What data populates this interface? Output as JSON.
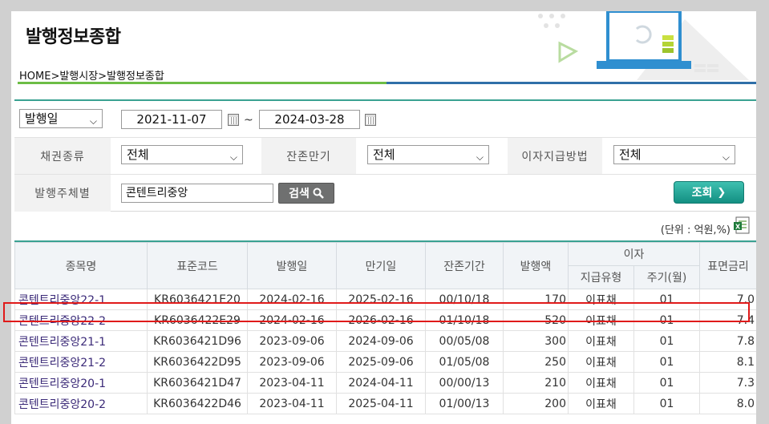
{
  "page": {
    "title": "발행정보종합",
    "breadcrumb": "HOME>발행시장>발행정보종합"
  },
  "search": {
    "date_type": "발행일",
    "date_from": "2021-11-07",
    "date_tilde": "~",
    "date_to": "2024-03-28",
    "bond_type_label": "채권종류",
    "bond_type_value": "전체",
    "remaining_label": "잔존만기",
    "remaining_value": "전체",
    "interest_method_label": "이자지급방법",
    "interest_method_value": "전체",
    "issuer_label": "발행주체별",
    "issuer_value": "콘텐트리중앙",
    "search_button": "검색",
    "query_button": "조회"
  },
  "unit_text": "(단위 : 억원,%)",
  "table": {
    "headers": {
      "name": "종목명",
      "code": "표준코드",
      "issue_date": "발행일",
      "maturity": "만기일",
      "remaining": "잔존기간",
      "amount": "발행액",
      "interest": "이자",
      "pay_type": "지급유형",
      "period": "주기(월)",
      "coupon": "표면금리"
    },
    "rows": [
      {
        "name": "콘텐트리중앙22-1",
        "code": "KR6036421E20",
        "issue": "2024-02-16",
        "maturity": "2025-02-16",
        "remaining": "00/10/18",
        "amount": "170",
        "pay_type": "이표채",
        "period": "01",
        "coupon": "7.0"
      },
      {
        "name": "콘텐트리중앙22-2",
        "code": "KR6036422E29",
        "issue": "2024-02-16",
        "maturity": "2026-02-16",
        "remaining": "01/10/18",
        "amount": "520",
        "pay_type": "이표채",
        "period": "01",
        "coupon": "7.4"
      },
      {
        "name": "콘텐트리중앙21-1",
        "code": "KR6036421D96",
        "issue": "2023-09-06",
        "maturity": "2024-09-06",
        "remaining": "00/05/08",
        "amount": "300",
        "pay_type": "이표채",
        "period": "01",
        "coupon": "7.8"
      },
      {
        "name": "콘텐트리중앙21-2",
        "code": "KR6036422D95",
        "issue": "2023-09-06",
        "maturity": "2025-09-06",
        "remaining": "01/05/08",
        "amount": "250",
        "pay_type": "이표채",
        "period": "01",
        "coupon": "8.1"
      },
      {
        "name": "콘텐트리중앙20-1",
        "code": "KR6036421D47",
        "issue": "2023-04-11",
        "maturity": "2024-04-11",
        "remaining": "00/00/13",
        "amount": "210",
        "pay_type": "이표채",
        "period": "01",
        "coupon": "7.3"
      },
      {
        "name": "콘텐트리중앙20-2",
        "code": "KR6036422D46",
        "issue": "2023-04-11",
        "maturity": "2025-04-11",
        "remaining": "01/00/13",
        "amount": "200",
        "pay_type": "이표채",
        "period": "01",
        "coupon": "8.0"
      }
    ],
    "highlighted_row": 1
  },
  "colors": {
    "accent_green": "#6cbd45",
    "accent_teal": "#3aa192",
    "accent_blue": "#2f6fa8",
    "highlight_red": "#e01a1a",
    "link_purple": "#3b2a78"
  }
}
